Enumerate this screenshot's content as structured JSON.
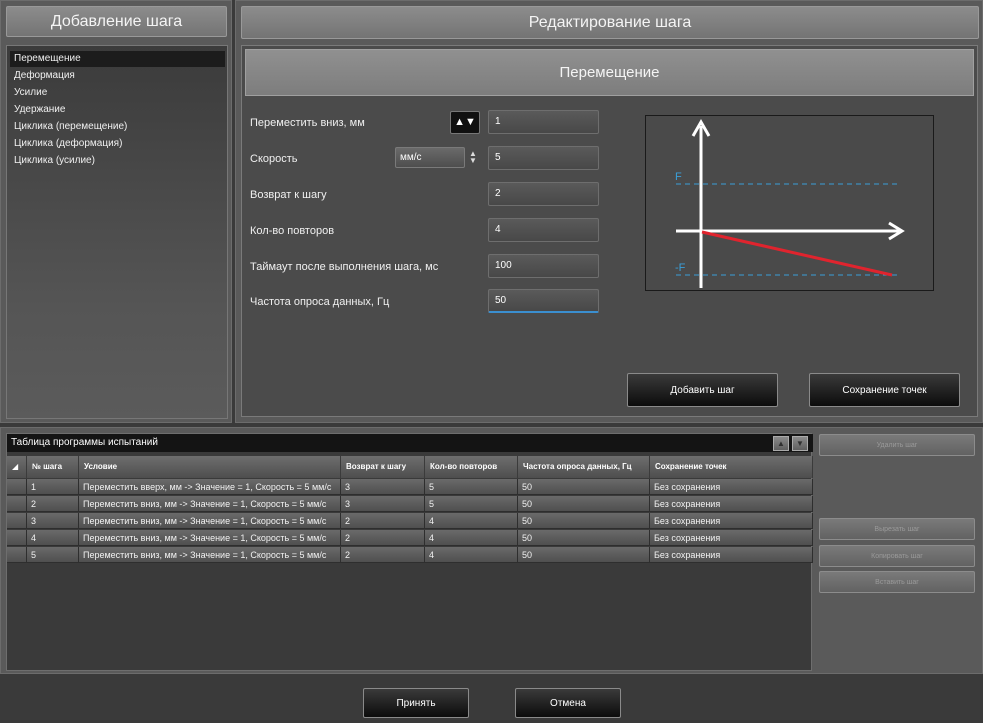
{
  "left_panel": {
    "title": "Добавление шага",
    "items": [
      {
        "label": "Перемещение"
      },
      {
        "label": "Деформация"
      },
      {
        "label": "Усилие"
      },
      {
        "label": "Удержание"
      },
      {
        "label": "Циклика (перемещение)"
      },
      {
        "label": "Циклика (деформация)"
      },
      {
        "label": "Циклика (усилие)"
      }
    ]
  },
  "right_panel": {
    "title": "Редактирование шага",
    "section_title": "Перемещение",
    "fields": {
      "move": {
        "label": "Переместить вниз, мм",
        "value": "1"
      },
      "speed": {
        "label": "Скорость",
        "value": "5"
      },
      "return": {
        "label": "Возврат к шагу",
        "value": "2"
      },
      "repeats": {
        "label": "Кол-во повторов",
        "value": "4"
      },
      "timeout": {
        "label": "Таймаут после выполнения шага, мс",
        "value": "100"
      },
      "frequency": {
        "label": "Частота опроса данных, Гц",
        "value": "50"
      }
    },
    "direction_toggle": "▲▼",
    "speed_unit": "мм/с",
    "graph": {
      "upper_label": "F",
      "lower_label": "-F",
      "line_color": "#e0242e",
      "dash_color": "#3a9fd8"
    },
    "add_step_button": "Добавить шаг",
    "save_points_button": "Сохранение точек"
  },
  "table": {
    "title": "Таблица программы испытаний",
    "up_arrow": "▲",
    "down_arrow": "▼",
    "sort_marker": "◢",
    "columns": [
      "№ шага",
      "Условие",
      "Возврат к шагу",
      "Кол-во повторов",
      "Частота опроса данных, Гц",
      "Сохранение точек"
    ],
    "rows": [
      {
        "num": "1",
        "condition": "Переместить вверх, мм -> Значение = 1, Скорость = 5 мм/с",
        "return": "3",
        "repeats": "5",
        "frequency": "50",
        "save": "Без сохранения"
      },
      {
        "num": "2",
        "condition": "Переместить вниз, мм -> Значение = 1, Скорость = 5 мм/с",
        "return": "3",
        "repeats": "5",
        "frequency": "50",
        "save": "Без сохранения"
      },
      {
        "num": "3",
        "condition": "Переместить вниз, мм -> Значение = 1, Скорость = 5 мм/с",
        "return": "2",
        "repeats": "4",
        "frequency": "50",
        "save": "Без сохранения"
      },
      {
        "num": "4",
        "condition": "Переместить вниз, мм -> Значение = 1, Скорость = 5 мм/с",
        "return": "2",
        "repeats": "4",
        "frequency": "50",
        "save": "Без сохранения"
      },
      {
        "num": "5",
        "condition": "Переместить вниз, мм -> Значение = 1, Скорость = 5 мм/с",
        "return": "2",
        "repeats": "4",
        "frequency": "50",
        "save": "Без сохранения"
      }
    ],
    "side_buttons": {
      "delete": "Удалить шаг",
      "cut": "Вырезать шаг",
      "copy": "Копировать шаг",
      "paste": "Вставить шаг"
    }
  },
  "footer": {
    "accept": "Принять",
    "cancel": "Отмена"
  }
}
